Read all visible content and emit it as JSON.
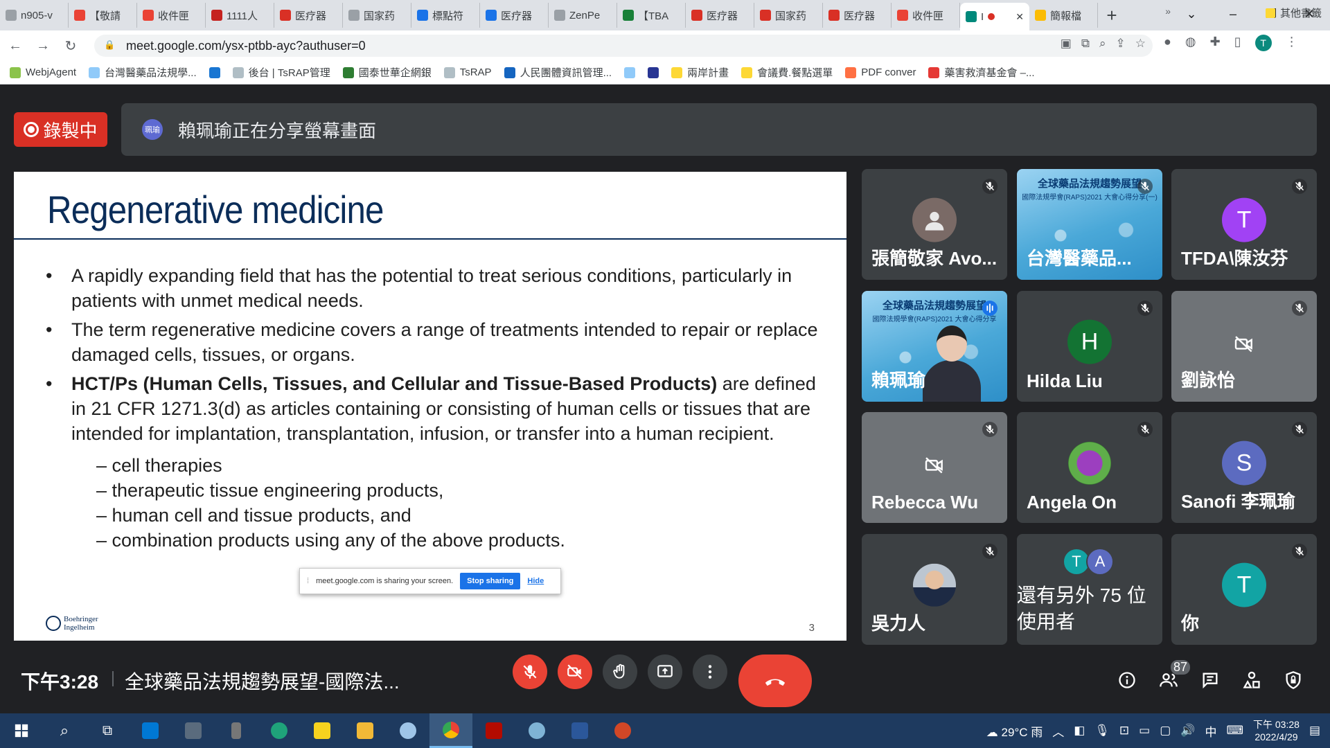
{
  "browser": {
    "tabs": [
      {
        "label": "n905-v",
        "color": "#9aa0a6"
      },
      {
        "label": "【敬請",
        "color": "#ea4335"
      },
      {
        "label": "收件匣",
        "color": "#ea4335"
      },
      {
        "label": "1111人",
        "color": "#c5221f"
      },
      {
        "label": "医疗器",
        "color": "#d93025"
      },
      {
        "label": "国家药",
        "color": "#9aa0a6"
      },
      {
        "label": "標點符",
        "color": "#1a73e8"
      },
      {
        "label": "医疗器",
        "color": "#1a73e8"
      },
      {
        "label": "ZenPe",
        "color": "#9aa0a6"
      },
      {
        "label": "【TBA",
        "color": "#188038"
      },
      {
        "label": "医疗器",
        "color": "#d93025"
      },
      {
        "label": "国家药",
        "color": "#d93025"
      },
      {
        "label": "医疗器",
        "color": "#d93025"
      },
      {
        "label": "收件匣",
        "color": "#ea4335"
      },
      {
        "label": "I",
        "color": "#00897b",
        "active": true
      },
      {
        "label": "簡報檔",
        "color": "#fbbc04"
      }
    ],
    "url": "meet.google.com/ysx-ptbb-ayc?authuser=0",
    "profile_initial": "T",
    "bookmarks": [
      {
        "label": "WebjAgent",
        "color": "#8bc34a"
      },
      {
        "label": "台灣醫藥品法規學...",
        "color": "#90caf9"
      },
      {
        "label": "",
        "color": "#1976d2"
      },
      {
        "label": "後台 | TsRAP管理",
        "color": "#b0bec5"
      },
      {
        "label": "國泰世華企網銀",
        "color": "#2e7d32"
      },
      {
        "label": "TsRAP",
        "color": "#b0bec5"
      },
      {
        "label": "人民團體資訊管理...",
        "color": "#1565c0"
      },
      {
        "label": "",
        "color": "#90caf9"
      },
      {
        "label": "",
        "color": "#283593"
      },
      {
        "label": "兩岸計畫",
        "color": "#fdd835"
      },
      {
        "label": "會議費.餐點選單",
        "color": "#fdd835"
      },
      {
        "label": "PDF conver",
        "color": "#ff7043"
      },
      {
        "label": "藥害救濟基金會 –...",
        "color": "#e53935"
      }
    ],
    "bookmarks_more": "»",
    "other_bookmarks": "其他書籤"
  },
  "meet": {
    "recording_label": "錄製中",
    "presenter_avatar_text": "珮瑜",
    "sharing_text": "賴珮瑜正在分享螢幕畫面",
    "time": "下午3:28",
    "meeting_title": "全球藥品法規趨勢展望-國際法...",
    "participant_count": "87",
    "colors": {
      "recording": "#d93025",
      "end_call": "#ea4335",
      "tile": "#3c4043"
    }
  },
  "slide": {
    "title": "Regenerative medicine",
    "bullets": [
      {
        "text": "A rapidly expanding field that has the potential to treat serious conditions, particularly in patients with unmet medical needs."
      },
      {
        "text": "The term regenerative medicine covers a range of treatments intended to repair or replace damaged cells, tissues, or organs."
      },
      {
        "bold": "HCT/Ps (Human Cells, Tissues, and Cellular and Tissue-Based Products)",
        "text": " are defined in 21 CFR 1271.3(d) as articles containing or consisting of human cells or tissues that are intended for implantation, transplantation, infusion, or transfer into a human recipient."
      }
    ],
    "subitems": [
      "– cell therapies",
      "– therapeutic tissue engineering products,",
      "– human cell and tissue products, and",
      "– combination products using any of the above products."
    ],
    "logo_line1": "Boehringer",
    "logo_line2": "Ingelheim",
    "page_number": "3",
    "sharing_popup": {
      "text": "meet.google.com is sharing your screen.",
      "stop": "Stop sharing",
      "hide": "Hide"
    }
  },
  "participants": [
    {
      "name": "張簡敬家 Avo...",
      "type": "default-avatar"
    },
    {
      "name": "台灣醫藥品...",
      "type": "share",
      "screen_title": "全球藥品法規趨勢展望",
      "screen_subtitle": "國際法規學會(RAPS)2021 大會心得分享(一)"
    },
    {
      "name": "TFDA\\陳汝芬",
      "type": "initial",
      "initial": "T",
      "color": "#a142f4"
    },
    {
      "name": "賴珮瑜",
      "type": "video",
      "screen_title": "全球藥品法規趨勢展望",
      "screen_subtitle": "國際法規學會(RAPS)2021 大會心得分享"
    },
    {
      "name": "Hilda Liu",
      "type": "initial",
      "initial": "H",
      "color": "#137333"
    },
    {
      "name": "劉詠怡",
      "type": "camoff"
    },
    {
      "name": "Rebecca Wu",
      "type": "camoff"
    },
    {
      "name": "Angela On",
      "type": "flower"
    },
    {
      "name": "Sanofi 李珮瑜",
      "type": "initial",
      "initial": "S",
      "color": "#5c6bc0"
    },
    {
      "name": "吳力人",
      "type": "photo"
    },
    {
      "name": "還有另外 75 位使用者",
      "type": "more",
      "initials": [
        "T",
        "A"
      ],
      "colors": [
        "#12a4a4",
        "#5c6bc0"
      ]
    },
    {
      "name": "你",
      "type": "initial",
      "initial": "T",
      "color": "#12a4a4"
    }
  ],
  "taskbar": {
    "weather": "29°C 雨",
    "ime": "中",
    "clock_time": "下午 03:28",
    "clock_date": "2022/4/29"
  }
}
